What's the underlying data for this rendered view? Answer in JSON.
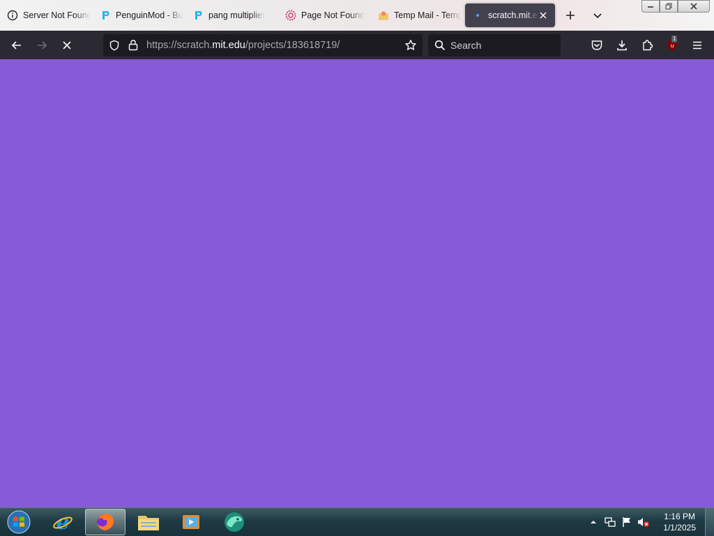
{
  "browser": {
    "tabs": [
      {
        "title": "Server Not Found",
        "favicon": "info-icon",
        "active": false
      },
      {
        "title": "PenguinMod - Build",
        "favicon": "penguinmod-icon",
        "active": false
      },
      {
        "title": "pang multiplier",
        "favicon": "penguinmod-icon",
        "active": false
      },
      {
        "title": "Page Not Found",
        "favicon": "scratch-gear-icon",
        "active": false
      },
      {
        "title": "Temp Mail - Temp",
        "favicon": "tempmail-icon",
        "active": false
      },
      {
        "title": "scratch.mit.edu",
        "favicon": "loading-dot-icon",
        "active": true
      }
    ],
    "url": {
      "prefix": "https://scratch.",
      "host": "mit.edu",
      "path": "/projects/183618719/"
    },
    "search": {
      "placeholder": "Search"
    },
    "extension_badge": "1",
    "colors": {
      "toolbar": "#2b2a33",
      "field": "#1c1b22",
      "page_background": "#875ad8"
    }
  },
  "taskbar": {
    "apps": [
      "internet-explorer-icon",
      "firefox-icon",
      "file-explorer-icon",
      "media-player-icon",
      "app-icon"
    ],
    "clock": {
      "time": "1:16 PM",
      "date": "1/1/2025"
    }
  }
}
